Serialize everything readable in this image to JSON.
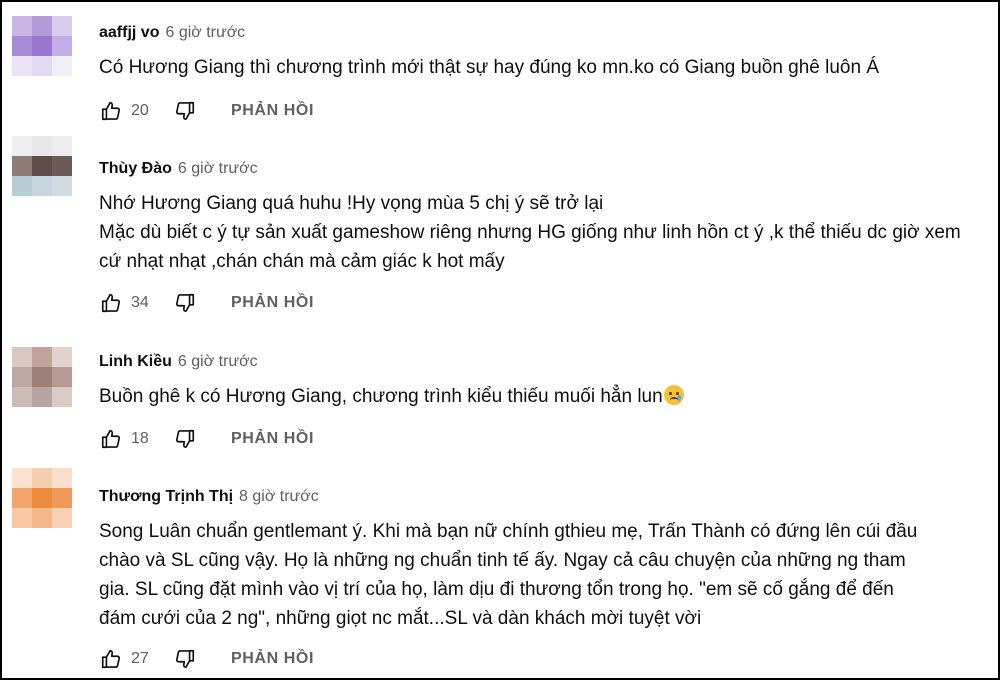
{
  "comments": [
    {
      "author": "aaffjj vo",
      "time": "6 giờ trước",
      "lines": [
        "Có Hương Giang thì chương trình mới thật sự hay đúng ko mn.ko có Giang buồn ghê luôn Á"
      ],
      "likes": "20",
      "reply_label": "PHẢN HỒI",
      "avatar_colors": [
        "#c9b4e6",
        "#b39ad8",
        "#d9ccee",
        "#a88bd6",
        "#9a78d0",
        "#c3aee6",
        "#ebe4f6",
        "#e2d9f2",
        "#f2eef9"
      ]
    },
    {
      "author": "Thùy Đào",
      "time": "6 giờ trước",
      "lines": [
        "Nhớ Hương Giang quá huhu !Hy vọng mùa 5 chị ý sẽ trở lại",
        "Mặc dù biết c ý tự sản xuất gameshow riêng nhưng HG giống như linh hồn ct ý ,k thể thiếu dc giờ xem",
        "cứ nhạt nhạt ,chán chán mà cảm giác k hot mấy"
      ],
      "likes": "34",
      "reply_label": "PHẢN HỒI",
      "avatar_colors": [
        "#f0eeee",
        "#e8e8ea",
        "#ececee",
        "#8f7b76",
        "#5e4c49",
        "#6c5a58",
        "#b9cdd6",
        "#c7d6de",
        "#cfdce2"
      ]
    },
    {
      "author": "Linh Kiều",
      "time": "6 giờ trước",
      "lines": [
        "Buồn ghê k có Hương Giang, chương trình kiểu thiếu muối hẳn lun"
      ],
      "emoji_after": "crying-face",
      "likes": "18",
      "reply_label": "PHẢN HỒI",
      "avatar_colors": [
        "#dcc8c2",
        "#c2a29a",
        "#e2d2cc",
        "#bfa8a3",
        "#9b7f79",
        "#b69993",
        "#cdbbb7",
        "#b8a5a1",
        "#d9cac6"
      ]
    },
    {
      "author": "Thương Trịnh Thị",
      "time": "8 giờ trước",
      "lines": [
        "Song Luân chuẩn gentlemant ý. Khi mà bạn nữ chính gthieu mẹ, Trấn Thành có đứng lên cúi đầu",
        "chào và SL cũng vậy. Họ là những ng chuẩn tinh tế ấy. Ngay cả câu chuyện của những ng tham",
        "gia. SL cũng đặt mình vào vị trí của họ, làm dịu đi thương tổn trong họ. \"em sẽ cố gắng để đến",
        "đám cưới của 2 ng\", những giọt nc mắt...SL và dàn khách mời tuyệt vời"
      ],
      "likes": "27",
      "reply_label": "PHẢN HỒI",
      "avatar_colors": [
        "#fbe3d0",
        "#f7cfae",
        "#fae0cc",
        "#f3a66f",
        "#ee8a3e",
        "#f09a5a",
        "#f8c9a4",
        "#f4b88b",
        "#f9d2b3"
      ]
    }
  ]
}
